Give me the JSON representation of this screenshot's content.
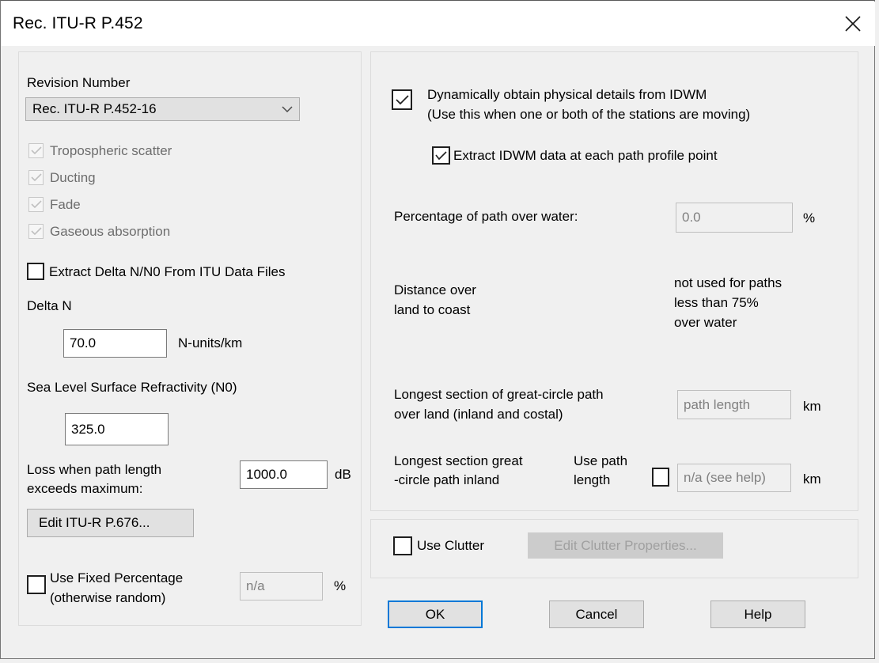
{
  "window": {
    "title": "Rec. ITU-R P.452",
    "close_icon": "close-icon"
  },
  "left_panel": {
    "revision_label": "Revision Number",
    "revision_value": "Rec. ITU-R P.452-16",
    "revision_options": [
      "Rec. ITU-R P.452-16"
    ],
    "dropdown_icon": "chevron-down-icon",
    "disabled_checkboxes": [
      {
        "label": "Tropospheric scatter",
        "checked": true
      },
      {
        "label": "Ducting",
        "checked": true
      },
      {
        "label": "Fade",
        "checked": true
      },
      {
        "label": "Gaseous absorption",
        "checked": true
      }
    ],
    "extract_delta": {
      "label": "Extract Delta N/N0 From ITU Data Files",
      "checked": false
    },
    "delta_n": {
      "label": "Delta N",
      "value": "70.0",
      "units": "N-units/km"
    },
    "sea_level": {
      "label": "Sea Level Surface Refractivity (N0)",
      "value": "325.0"
    },
    "loss": {
      "label_line1": "Loss when path length",
      "label_line2": "exceeds maximum:",
      "value": "1000.0",
      "units": "dB"
    },
    "edit_itu_button": "Edit ITU-R P.676...",
    "fixed_percentage": {
      "label_line1": "Use Fixed Percentage",
      "label_line2": "(otherwise random)",
      "checked": false,
      "placeholder": "n/a",
      "units": "%"
    }
  },
  "right_panel": {
    "dynamic_idwm": {
      "label_line1": "Dynamically obtain physical details from IDWM",
      "label_line2": "(Use this when one or both of the stations are moving)",
      "checked": true
    },
    "extract_idwm": {
      "label": "Extract IDWM data at each path profile point",
      "checked": true
    },
    "percent_water": {
      "label": "Percentage of path over water:",
      "value": "0.0",
      "units": "%"
    },
    "distance_coast": {
      "label_line1": "Distance over",
      "label_line2": "land to coast",
      "note_line1": "not used for paths",
      "note_line2": "less than 75%",
      "note_line3": "over water"
    },
    "longest_land": {
      "label_line1": "Longest section of great-circle path",
      "label_line2": "over land (inland and costal)",
      "placeholder": "path length",
      "units": "km"
    },
    "longest_inland": {
      "label_line1": "Longest section great",
      "label_line2": "-circle path inland",
      "use_path_line1": "Use path",
      "use_path_line2": "length",
      "checked": false,
      "placeholder": "n/a (see help)",
      "units": "km"
    },
    "clutter": {
      "label": "Use Clutter",
      "checked": false,
      "button": "Edit Clutter Properties..."
    }
  },
  "footer": {
    "ok": "OK",
    "cancel": "Cancel",
    "help": "Help"
  },
  "colors": {
    "accent": "#0078d7",
    "dialog_bg": "#f0f0f0",
    "titlebar_bg": "#ffffff",
    "disabled_text": "#808080"
  }
}
